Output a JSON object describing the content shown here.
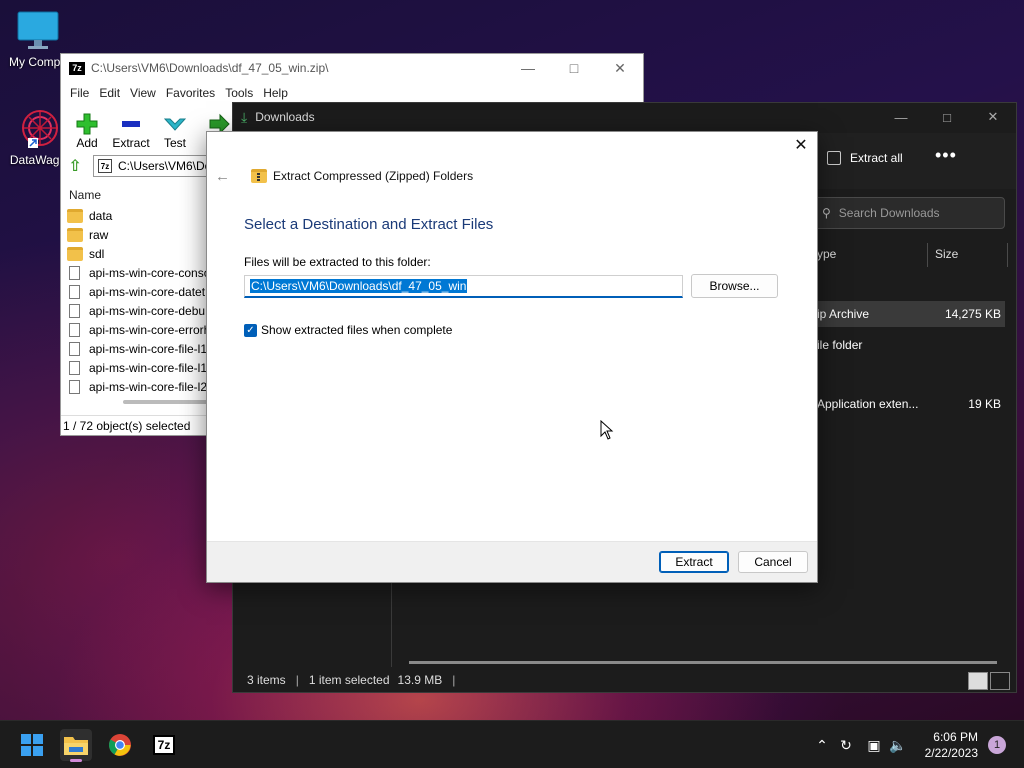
{
  "desktop": {
    "icons": [
      {
        "label": "My Compu"
      },
      {
        "label": "DataWago"
      }
    ]
  },
  "zipwin": {
    "title": "C:\\Users\\VM6\\Downloads\\df_47_05_win.zip\\",
    "logo": "7z",
    "menu": [
      "File",
      "Edit",
      "View",
      "Favorites",
      "Tools",
      "Help"
    ],
    "toolbar": [
      "Add",
      "Extract",
      "Test",
      "Co"
    ],
    "path": "C:\\Users\\VM6\\Do",
    "column_name": "Name",
    "rows": [
      {
        "name": "data",
        "type": "folder"
      },
      {
        "name": "raw",
        "type": "folder"
      },
      {
        "name": "sdl",
        "type": "folder"
      },
      {
        "name": "api-ms-win-core-conso",
        "type": "file"
      },
      {
        "name": "api-ms-win-core-datet",
        "type": "file"
      },
      {
        "name": "api-ms-win-core-debu",
        "type": "file"
      },
      {
        "name": "api-ms-win-core-errorh",
        "type": "file"
      },
      {
        "name": "api-ms-win-core-file-l1",
        "type": "file"
      },
      {
        "name": "api-ms-win-core-file-l1",
        "type": "file"
      },
      {
        "name": "api-ms-win-core-file-l2",
        "type": "file"
      }
    ],
    "status": "1 / 72 object(s) selected"
  },
  "explorer": {
    "title": "Downloads",
    "extract_all": "Extract all",
    "more": "•••",
    "search_placeholder": "Search Downloads",
    "col_type": "ype",
    "col_size": "Size",
    "rows": [
      {
        "type": "ip Archive",
        "size": "14,275 KB",
        "selected": true
      },
      {
        "type": "ile folder",
        "size": ""
      },
      {
        "type": "Application exten...",
        "size": "19 KB"
      }
    ],
    "status": {
      "items": "3 items",
      "selected": "1 item selected",
      "size": "13.9 MB"
    }
  },
  "dialog": {
    "nav_title": "Extract Compressed (Zipped) Folders",
    "heading": "Select a Destination and Extract Files",
    "dest_label": "Files will be extracted to this folder:",
    "dest_path": "C:\\Users\\VM6\\Downloads\\df_47_05_win",
    "browse": "Browse...",
    "show_files_label": "Show extracted files when complete",
    "show_files_checked": true,
    "extract": "Extract",
    "cancel": "Cancel"
  },
  "taskbar": {
    "time": "6:06 PM",
    "date": "2/22/2023",
    "notifications": "1",
    "app_7z_label": "7z"
  },
  "colors": {
    "accent": "#005fb8",
    "selection": "#0078d4",
    "heading": "#1a3a78"
  }
}
